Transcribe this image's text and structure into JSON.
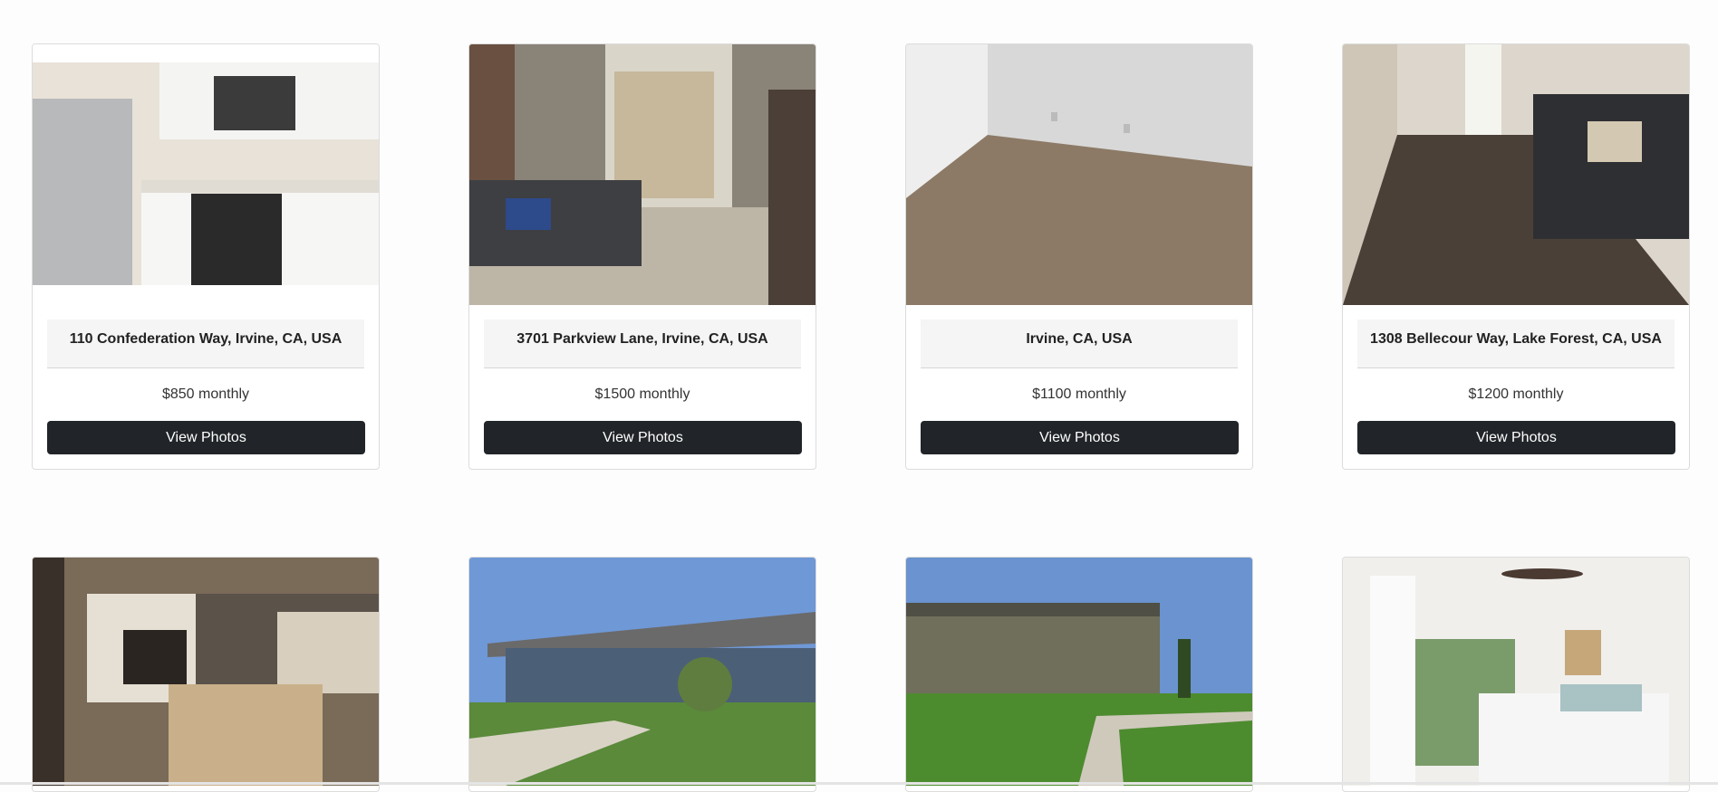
{
  "listings": [
    {
      "address": "110 Confederation Way, Irvine, CA, USA",
      "price": "$850 monthly",
      "button": "View Photos",
      "photo": "kitchen-photo"
    },
    {
      "address": "3701 Parkview Lane, Irvine, CA, USA",
      "price": "$1500 monthly",
      "button": "View Photos",
      "photo": "living-room-photo"
    },
    {
      "address": "Irvine, CA, USA",
      "price": "$1100 monthly",
      "button": "View Photos",
      "photo": "empty-carpet-room-photo"
    },
    {
      "address": "1308 Bellecour Way, Lake Forest, CA, USA",
      "price": "$1200 monthly",
      "button": "View Photos",
      "photo": "hardwood-living-room-photo"
    }
  ],
  "partial_listings": [
    {
      "photo": "fireplace-living-room-photo"
    },
    {
      "photo": "blue-house-exterior-photo"
    },
    {
      "photo": "apartment-complex-photo"
    },
    {
      "photo": "bedroom-photo"
    }
  ],
  "colors": {
    "button_bg": "#212529",
    "card_border": "#dcdcdc",
    "address_bg": "#f5f5f5"
  }
}
